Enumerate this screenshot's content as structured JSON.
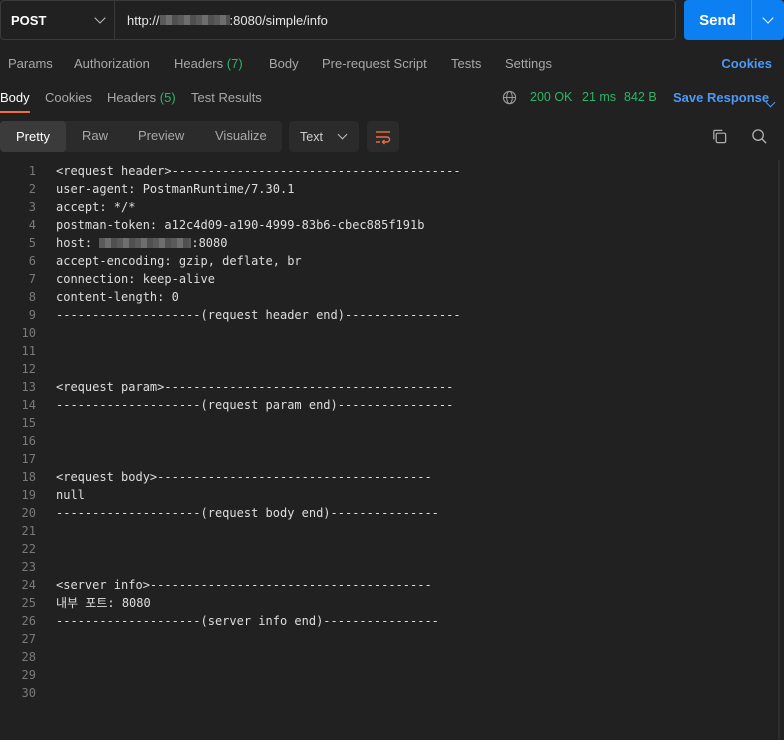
{
  "request": {
    "method": "POST",
    "url_prefix": "http://",
    "url_suffix": ":8080/simple/info",
    "send_label": "Send"
  },
  "request_tabs": {
    "params": "Params",
    "authorization": "Authorization",
    "headers": "Headers",
    "headers_count": "(7)",
    "body": "Body",
    "pre_request": "Pre-request Script",
    "tests": "Tests",
    "settings": "Settings",
    "cookies": "Cookies"
  },
  "response_tabs": {
    "body": "Body",
    "cookies": "Cookies",
    "headers": "Headers",
    "headers_count": "(5)",
    "test_results": "Test Results"
  },
  "response_status": {
    "status": "200 OK",
    "time": "21 ms",
    "size": "842 B",
    "save_label": "Save Response"
  },
  "view_modes": {
    "pretty": "Pretty",
    "raw": "Raw",
    "preview": "Preview",
    "visualize": "Visualize",
    "format": "Text"
  },
  "colors": {
    "accent": "#f26b3a",
    "link": "#4a9af5",
    "success": "#2fb36a",
    "send": "#0c7ff2"
  },
  "icons": [
    "chevron-down-icon",
    "globe-icon",
    "wrap-lines-icon",
    "copy-icon",
    "search-icon"
  ],
  "code_lines": [
    {
      "num": "1",
      "text": "<request header>----------------------------------------"
    },
    {
      "num": "2",
      "text": "user-agent: PostmanRuntime/7.30.1"
    },
    {
      "num": "3",
      "text": "accept: */*"
    },
    {
      "num": "4",
      "text": "postman-token: a12c4d09-a190-4999-83b6-cbec885f191b"
    },
    {
      "num": "5",
      "text": "host: ",
      "after_redact": ":8080"
    },
    {
      "num": "6",
      "text": "accept-encoding: gzip, deflate, br"
    },
    {
      "num": "7",
      "text": "connection: keep-alive"
    },
    {
      "num": "8",
      "text": "content-length: 0"
    },
    {
      "num": "9",
      "text": "--------------------(request header end)----------------"
    },
    {
      "num": "10",
      "text": ""
    },
    {
      "num": "11",
      "text": ""
    },
    {
      "num": "12",
      "text": ""
    },
    {
      "num": "13",
      "text": "<request param>----------------------------------------"
    },
    {
      "num": "14",
      "text": "--------------------(request param end)----------------"
    },
    {
      "num": "15",
      "text": ""
    },
    {
      "num": "16",
      "text": ""
    },
    {
      "num": "17",
      "text": ""
    },
    {
      "num": "18",
      "text": "<request body>--------------------------------------"
    },
    {
      "num": "19",
      "text": "null"
    },
    {
      "num": "20",
      "text": "--------------------(request body end)---------------"
    },
    {
      "num": "21",
      "text": ""
    },
    {
      "num": "22",
      "text": ""
    },
    {
      "num": "23",
      "text": ""
    },
    {
      "num": "24",
      "text": "<server info>---------------------------------------"
    },
    {
      "num": "25",
      "text": "내부 포트: 8080"
    },
    {
      "num": "26",
      "text": "--------------------(server info end)----------------"
    },
    {
      "num": "27",
      "text": ""
    },
    {
      "num": "28",
      "text": ""
    },
    {
      "num": "29",
      "text": ""
    },
    {
      "num": "30",
      "text": ""
    }
  ]
}
